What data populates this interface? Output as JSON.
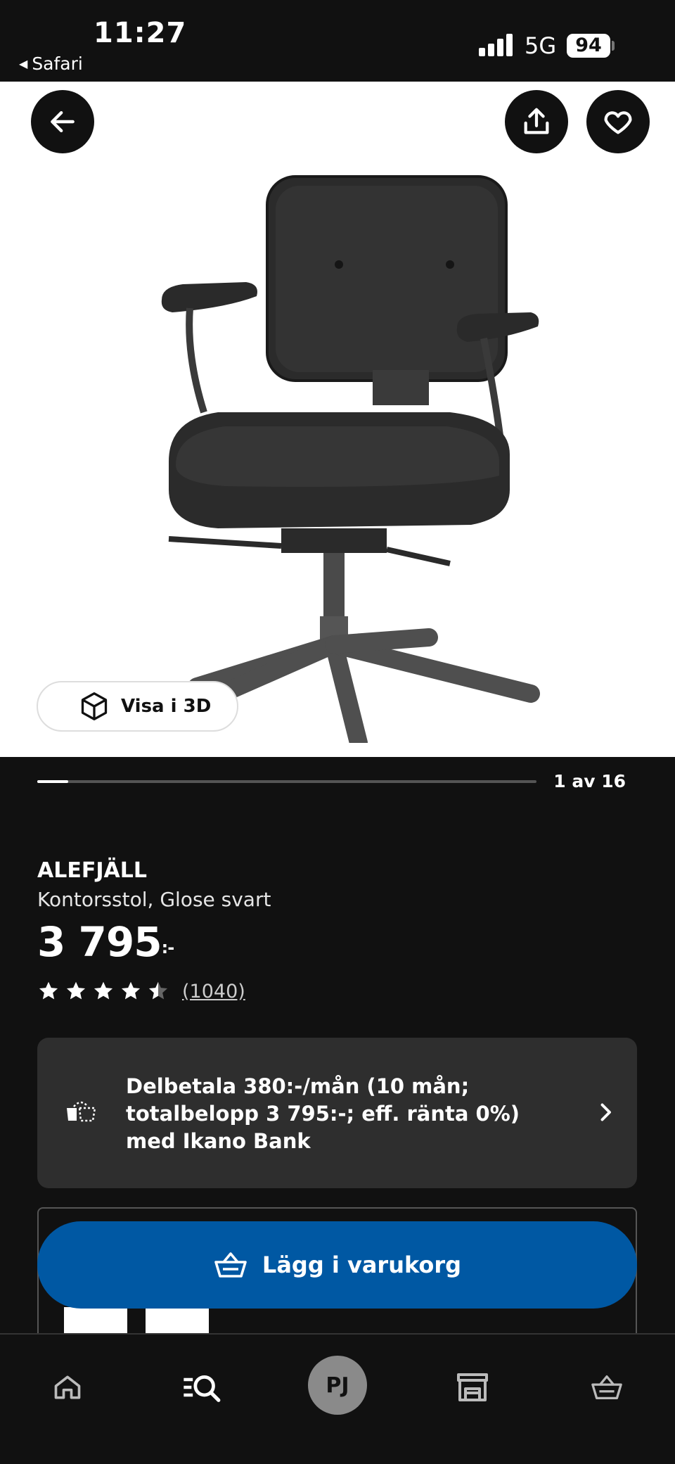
{
  "status_bar": {
    "time": "11:27",
    "back_app": "Safari",
    "network": "5G",
    "battery": "94"
  },
  "gallery": {
    "view_3d_label": "Visa i 3D",
    "counter": "1 av 16",
    "progress_fraction": 0.0625
  },
  "product": {
    "name": "ALEFJÄLL",
    "description": "Kontorsstol, Glose svart",
    "price": "3 795",
    "price_suffix": ":-",
    "rating_stars": 4.5,
    "review_count": "(1040)"
  },
  "financing": {
    "text": "Delbetala 380:-/mån (10 mån; totalbelopp 3 795:-; eff. ränta 0%) med Ikano Bank"
  },
  "cta": {
    "add_to_cart_label": "Lägg i varukorg",
    "color": "#0058a3"
  },
  "nav": {
    "profile_initials": "PJ",
    "items": [
      "home-icon",
      "search-icon",
      "profile-avatar",
      "store-icon",
      "cart-icon"
    ]
  }
}
